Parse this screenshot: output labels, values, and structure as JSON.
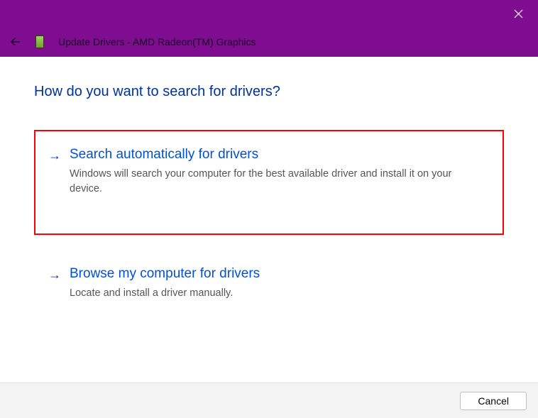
{
  "window": {
    "title": "Update Drivers - AMD Radeon(TM) Graphics"
  },
  "heading": "How do you want to search for drivers?",
  "options": [
    {
      "title": "Search automatically for drivers",
      "description": "Windows will search your computer for the best available driver and install it on your device.",
      "highlighted": true
    },
    {
      "title": "Browse my computer for drivers",
      "description": "Locate and install a driver manually.",
      "highlighted": false
    }
  ],
  "footer": {
    "cancel_label": "Cancel"
  }
}
